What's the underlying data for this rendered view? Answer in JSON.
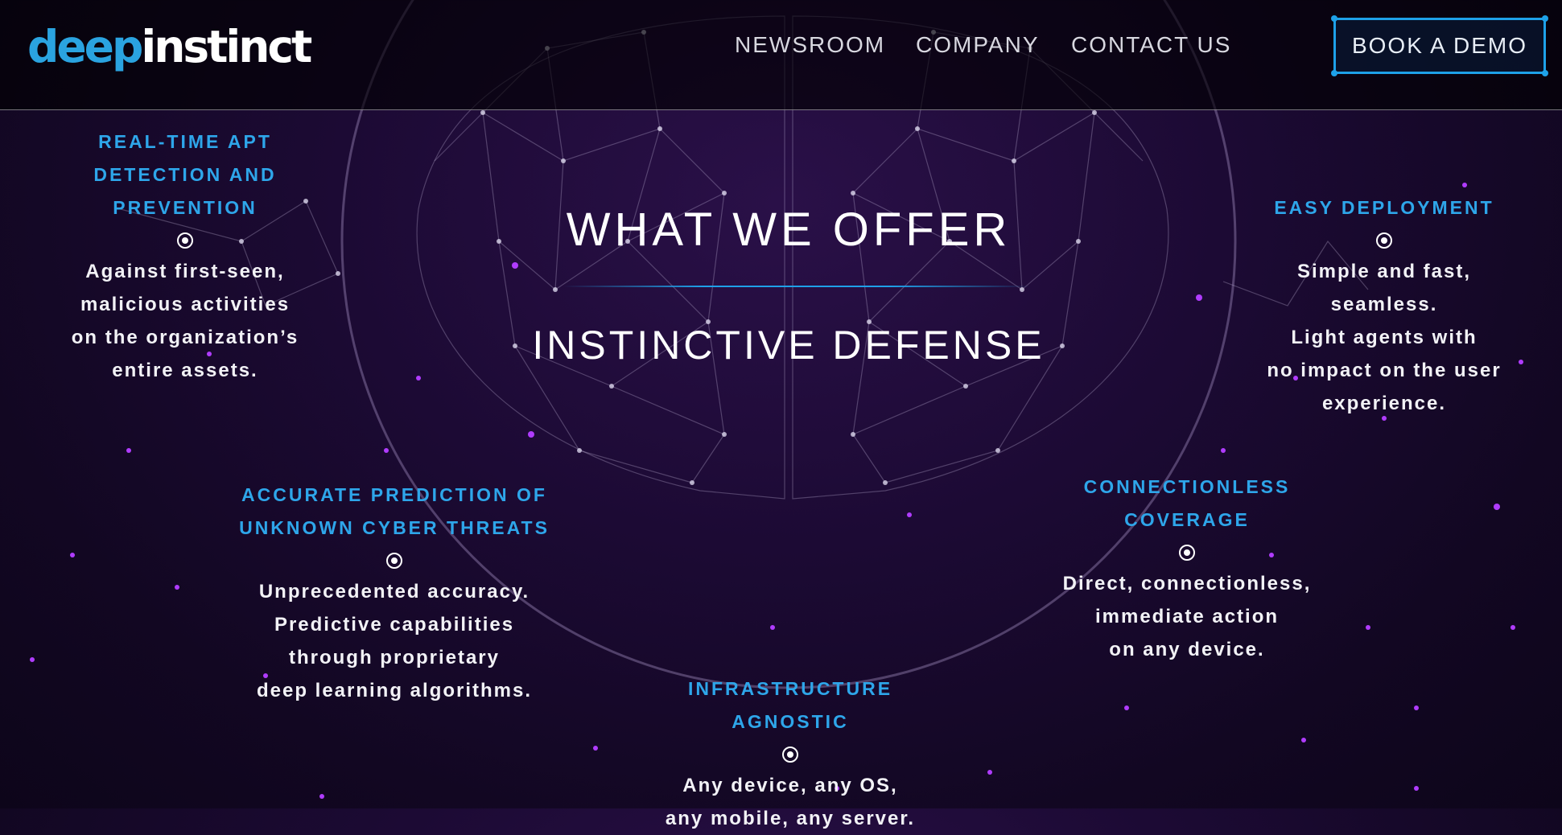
{
  "header": {
    "logo_left": "deep",
    "logo_right": "instinct",
    "nav": [
      "NEWSROOM",
      "COMPANY",
      "CONTACT US"
    ],
    "cta_label": "BOOK A DEMO"
  },
  "hero": {
    "title": "WHAT WE OFFER",
    "subtitle": "INSTINCTIVE DEFENSE"
  },
  "features": [
    {
      "title": "REAL-TIME APT\nDETECTION AND\nPREVENTION",
      "desc": "Against first-seen,\nmalicious activities\non the organization’s\nentire assets."
    },
    {
      "title": "EASY DEPLOYMENT",
      "desc": "Simple and fast,\nseamless.\nLight agents with\nno impact on the user experience."
    },
    {
      "title": "ACCURATE PREDICTION OF\nUNKNOWN CYBER THREATS",
      "desc": "Unprecedented accuracy.\nPredictive capabilities\nthrough proprietary\ndeep learning algorithms."
    },
    {
      "title": "CONNECTIONLESS\nCOVERAGE",
      "desc": "Direct, connectionless,\nimmediate action\non any device."
    },
    {
      "title": "INFRASTRUCTURE AGNOSTIC",
      "desc": "Any device, any OS,\nany mobile, any server."
    }
  ],
  "colors": {
    "accent": "#1ea1e8",
    "background": "#1a0a30",
    "particle": "#b03cff"
  },
  "icons": [
    "target-dot-icon"
  ]
}
